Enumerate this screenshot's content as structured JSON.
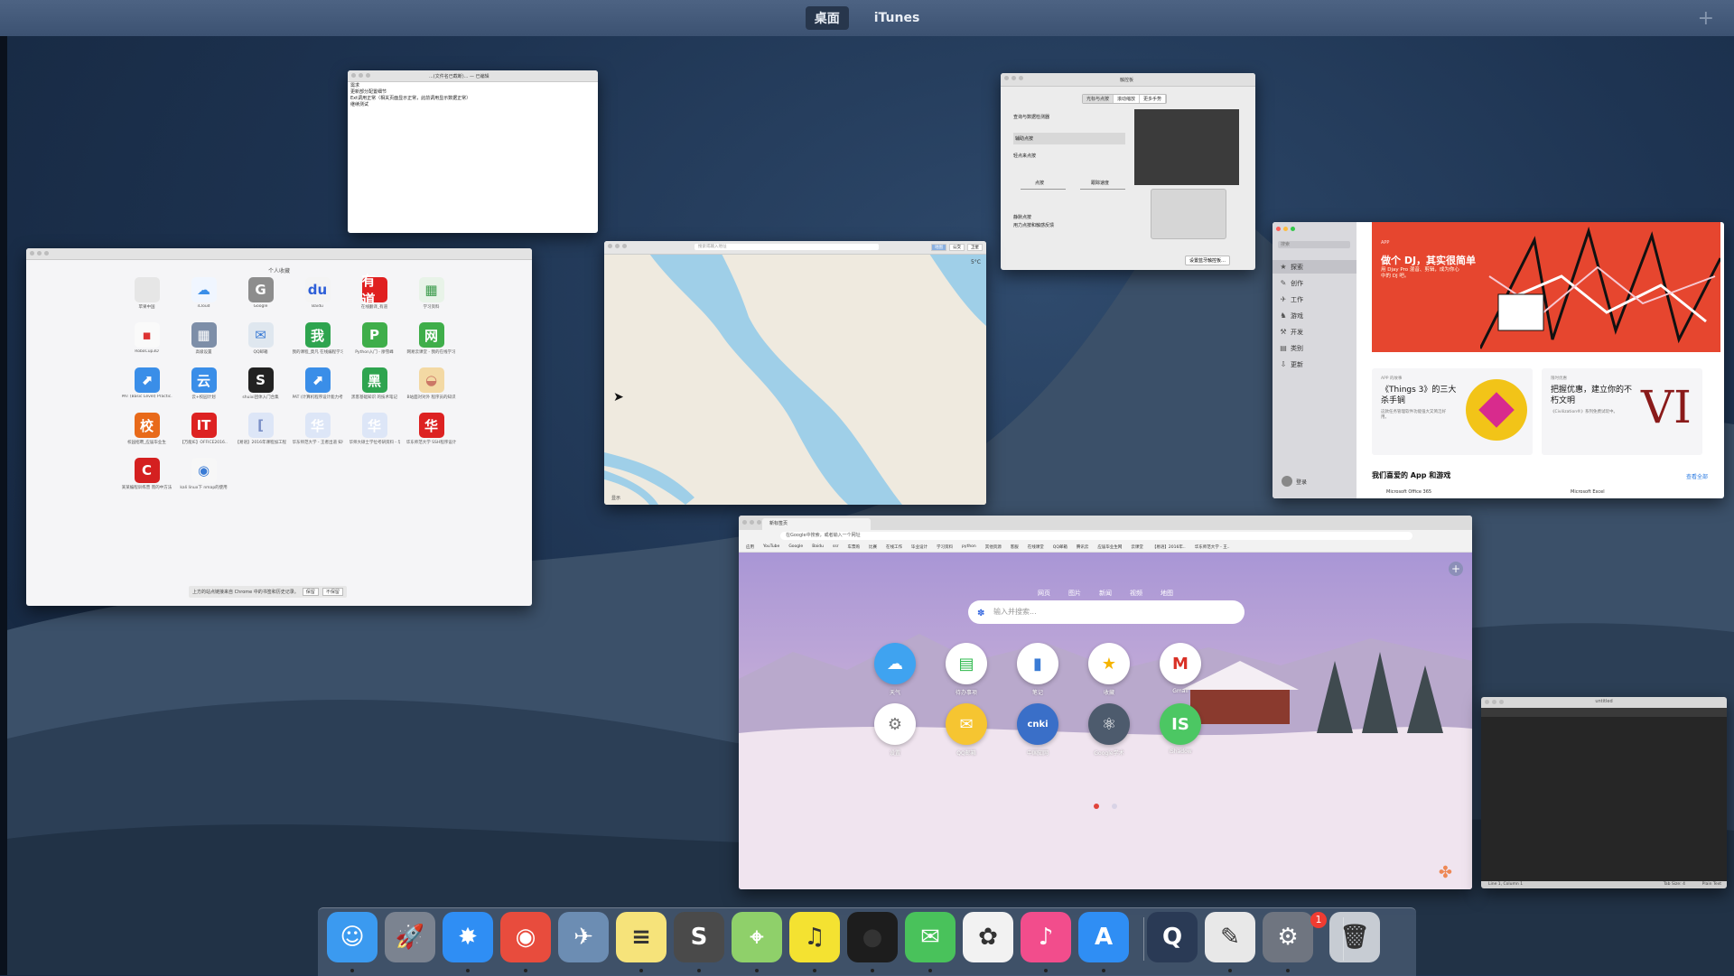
{
  "spaces": {
    "tabs": [
      "桌面",
      "iTunes"
    ],
    "add": "+"
  },
  "text_window": {
    "title": "...(文件名已截断)... — 已编辑",
    "lines": [
      "需求",
      "更新部分配置细节",
      "Ext调用正常（相关页面显示正常，此前调用显示数据正常）",
      "继续测试"
    ]
  },
  "prefs": {
    "title": "触控板",
    "segments": [
      "光标与点按",
      "滚动缩放",
      "更多手势"
    ],
    "items": [
      "查询与数据检测器",
      "辅助点按",
      "轻点来点按"
    ],
    "sliders": [
      "点按",
      "跟踪速度"
    ],
    "checks": [
      "静默点按",
      "用力点按和触感反馈"
    ],
    "button": "设置蓝牙触控板…"
  },
  "apps": {
    "heading": "个人收藏",
    "items": [
      {
        "label": "苹果中国",
        "glyph": "",
        "color": "#e6e6e6",
        "fg": "#333"
      },
      {
        "label": "iCloud",
        "glyph": "☁",
        "color": "#f0f6ff",
        "fg": "#3a8ee8"
      },
      {
        "label": "Google",
        "glyph": "G",
        "color": "#8d8d8d",
        "fg": "#fff"
      },
      {
        "label": "Baidu",
        "glyph": "du",
        "color": "#f4f4f4",
        "fg": "#2e5fd8"
      },
      {
        "label": "在线翻译_有道",
        "glyph": "有道",
        "color": "#e02020",
        "fg": "#fff"
      },
      {
        "label": "学习资料",
        "glyph": "▦",
        "color": "#e8f3e8",
        "fg": "#3a9a4a"
      },
      {
        "label": "RoboCup3D",
        "glyph": "▪",
        "color": "#fafafa",
        "fg": "#d33"
      },
      {
        "label": "高级设置",
        "glyph": "▦",
        "color": "#7d8ea8",
        "fg": "#fff"
      },
      {
        "label": "QQ邮箱",
        "glyph": "✉",
        "color": "#dfe7ef",
        "fg": "#3a7bd5"
      },
      {
        "label": "我的课程_莫凡 在线编程学习",
        "glyph": "我",
        "color": "#2ea44f",
        "fg": "#fff"
      },
      {
        "label": "Python入门 - 廖雪峰",
        "glyph": "P",
        "color": "#3fae4a",
        "fg": "#fff"
      },
      {
        "label": "网易云课堂 - 我的在线学习",
        "glyph": "网",
        "color": "#3fae4a",
        "fg": "#fff"
      },
      {
        "label": "PAT (Basic Level) Practic..",
        "glyph": "⬈",
        "color": "#3a8ee8",
        "fg": "#fff"
      },
      {
        "label": "云+校园计划",
        "glyph": "云",
        "color": "#3a8ee8",
        "fg": "#fff"
      },
      {
        "label": "shuixi团体入门合集",
        "glyph": "S",
        "color": "#222",
        "fg": "#fff"
      },
      {
        "label": "PAT (计算机程序设计能力考试",
        "glyph": "⬈",
        "color": "#3a8ee8",
        "fg": "#fff"
      },
      {
        "label": "黑客基础知识 的技术笔记",
        "glyph": "黑",
        "color": "#2ea44f",
        "fg": "#fff"
      },
      {
        "label": "B站面对对外 程序员的知识",
        "glyph": "◒",
        "color": "#f3d9a4",
        "fg": "#c76"
      },
      {
        "label": "校园招聘_应届毕业生",
        "glyph": "校",
        "color": "#e86a1a",
        "fg": "#fff"
      },
      {
        "label": "【万能IE】OFFICE2016..",
        "glyph": "IT",
        "color": "#d22",
        "fg": "#fff"
      },
      {
        "label": "【易语】2016年课程加工程学",
        "glyph": "[",
        "color": "#dde6f7",
        "fg": "#7a8fc7"
      },
      {
        "label": "华东师范大学 - 王者出道 知乎",
        "glyph": "华",
        "color": "#dde6f7",
        "fg": "#fff"
      },
      {
        "label": "华师大硕士学位考研资料 - 华",
        "glyph": "华",
        "color": "#dde6f7",
        "fg": "#fff"
      },
      {
        "label": "华东师范大学 SSH程序设计",
        "glyph": "华",
        "color": "#d22",
        "fg": "#fff"
      },
      {
        "label": "某某编程训练营 而的中方法",
        "glyph": "C",
        "color": "#d42020",
        "fg": "#fff"
      },
      {
        "label": "kali linux下 nmap的使用",
        "glyph": "◉",
        "color": "#f7f7f7",
        "fg": "#3a7bd5"
      }
    ],
    "save_prompt": "上方的站点链接来自 Chrome 中的书签和历史记录。",
    "save_btn": "保留",
    "discard_btn": "不保留"
  },
  "maps": {
    "search_placeholder": "搜索或输入地址",
    "modes": [
      "地图",
      "公交",
      "卫星"
    ],
    "temperature": "5°C",
    "show": "显示"
  },
  "store": {
    "search": "搜索",
    "nav": [
      {
        "icon": "★",
        "label": "探索"
      },
      {
        "icon": "✎",
        "label": "创作"
      },
      {
        "icon": "✈",
        "label": "工作"
      },
      {
        "icon": "♞",
        "label": "游戏"
      },
      {
        "icon": "⚒",
        "label": "开发"
      },
      {
        "icon": "▤",
        "label": "类别"
      },
      {
        "icon": "⇩",
        "label": "更新"
      }
    ],
    "user": "登录",
    "banner_tag": "APP",
    "banner_title": "做个 DJ，其实很简单",
    "banner_sub": "用 Djay Pro 混音、剪辑，成为你心中的 DJ 吧。",
    "card1_kicker": "APP 的故事",
    "card1_title": "《Things 3》的三大杀手锏",
    "card1_sub": "这款任务管理软件功能强大又简洁好用。",
    "card2_kicker": "限时优惠",
    "card2_title": "把握优惠，建立你的不朽文明",
    "card2_sub": "《Civilization®》系列免费试玩中。",
    "section": "我们喜爱的 App 和游戏",
    "see_all": "查看全部",
    "app1": "Microsoft Office 365",
    "app2": "Microsoft Excel",
    "vi": "VI"
  },
  "browser": {
    "tab": "新标签页",
    "url": "在Google中搜索，或者输入一个网址",
    "bookmarks": [
      "应用",
      "YouTube",
      "Google",
      "Baidu",
      "ssr",
      "车票购",
      "比赛",
      "在线工作",
      "毕业设计",
      "学习资料",
      "python",
      "其他资源",
      "客服",
      "在线课堂",
      "QQ邮箱",
      "腾讯云",
      "应届毕业生网",
      "云课堂",
      "【易语】2016年..",
      "华东师范大学 - 王.."
    ],
    "nav": [
      "网页",
      "图片",
      "新闻",
      "视频",
      "地图"
    ],
    "search_placeholder": "输入并搜索...",
    "plus": "+",
    "sites": [
      {
        "label": "天气",
        "glyph": "☁",
        "color": "#3fa3f0"
      },
      {
        "label": "待办事项",
        "glyph": "▤",
        "color": "#ffffff",
        "fg": "#2eb84c"
      },
      {
        "label": "笔记",
        "glyph": "▮",
        "color": "#ffffff",
        "fg": "#3a7bd5"
      },
      {
        "label": "收藏",
        "glyph": "★",
        "color": "#ffffff",
        "fg": "#f5b400"
      },
      {
        "label": "Gmail",
        "glyph": "M",
        "color": "#ffffff",
        "fg": "#d93025"
      },
      {
        "label": "设置",
        "glyph": "⚙",
        "color": "#ffffff",
        "fg": "#777"
      },
      {
        "label": "QQ邮箱",
        "glyph": "✉",
        "color": "#f6c531"
      },
      {
        "label": "中国知网",
        "glyph": "cnki",
        "color": "#3a6fc8"
      },
      {
        "label": "Google学术",
        "glyph": "⚛",
        "color": "#4d5b6d"
      },
      {
        "label": "iShadow",
        "glyph": "IS",
        "color": "#4cc763"
      }
    ]
  },
  "sublime": {
    "title": "untitled",
    "status": "Line 1, Column 1",
    "tab_size": "Tab Size: 4",
    "syntax": "Plain Text"
  },
  "dock": {
    "apps": [
      {
        "name": "finder-icon",
        "glyph": "☺",
        "color": "#3b9af0"
      },
      {
        "name": "launchpad-icon",
        "glyph": "🚀",
        "color": "#7b8390"
      },
      {
        "name": "safari-icon",
        "glyph": "✸",
        "color": "#2f8ef4"
      },
      {
        "name": "chrome-icon",
        "glyph": "◉",
        "color": "#e84c3d"
      },
      {
        "name": "preview-icon",
        "glyph": "✈",
        "color": "#6c8db3"
      },
      {
        "name": "notes-icon",
        "glyph": "≡",
        "color": "#f6e37a"
      },
      {
        "name": "sublime-icon",
        "glyph": "S",
        "color": "#4a4a4a"
      },
      {
        "name": "maps-icon",
        "glyph": "⌖",
        "color": "#8fd06a"
      },
      {
        "name": "qqmusic-icon",
        "glyph": "♫",
        "color": "#f4e231"
      },
      {
        "name": "qq-icon",
        "glyph": "●",
        "color": "#1d1d1d"
      },
      {
        "name": "wechat-icon",
        "glyph": "✉",
        "color": "#49c25b"
      },
      {
        "name": "photos-icon",
        "glyph": "✿",
        "color": "#f2f2f2"
      },
      {
        "name": "itunes-icon",
        "glyph": "♪",
        "color": "#f24d8c"
      },
      {
        "name": "appstore-icon",
        "glyph": "A",
        "color": "#2f8ef4"
      },
      {
        "name": "quicktime-icon",
        "glyph": "Q",
        "color": "#2a3a55"
      },
      {
        "name": "textedit-icon",
        "glyph": "✎",
        "color": "#e8e8e8"
      },
      {
        "name": "system-preferences-icon",
        "glyph": "⚙",
        "color": "#6f7580"
      },
      {
        "name": "trash-icon",
        "glyph": "🗑",
        "color": "#c7ccd3"
      }
    ],
    "prefs_badge": "1"
  }
}
